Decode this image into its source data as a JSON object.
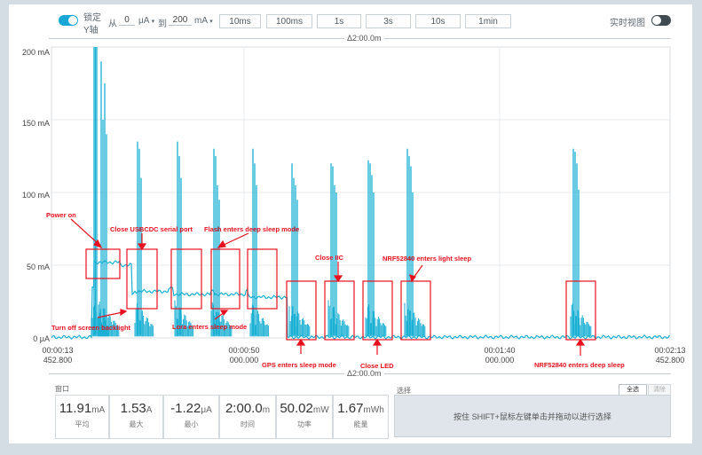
{
  "toolbar": {
    "lock_label": "锁定",
    "yaxis_label": "Y轴",
    "from_label": "从",
    "from_value": "0",
    "from_unit": "μA",
    "to_label": "到",
    "to_value": "200",
    "to_unit": "mA",
    "time_buttons": [
      "10ms",
      "100ms",
      "1s",
      "3s",
      "10s",
      "1min"
    ],
    "realtime_label": "实时视图",
    "lock_toggle_on": true,
    "realtime_toggle_on": false
  },
  "chart": {
    "duration_top": "Δ2:00.0m",
    "duration_bottom": "Δ2:00.0m",
    "y_ticks": [
      "200 mA",
      "150 mA",
      "100 mA",
      "50 mA",
      "0 μA"
    ],
    "x_ticks": [
      {
        "time": "00:00:13",
        "sub": "452.800"
      },
      {
        "time": "00:00:50",
        "sub": "000.000"
      },
      {
        "time": "00:01:40",
        "sub": "000.000"
      },
      {
        "time": "00:02:13",
        "sub": "452.800"
      }
    ],
    "trace_color": "#1ab0d4",
    "annotation_color": "#e8101e"
  },
  "annotations": [
    "Power on",
    "Close USBCDC serial port",
    "Flash enters deep sleep mode",
    "Close IIC",
    "NRF52840 enters light sleep",
    "Turn off screen backlight",
    "Lora enters sleep mode",
    "GPS enters sleep mode",
    "Close LED",
    "NRF52840 enters deep sleep"
  ],
  "window": {
    "title": "窗口",
    "stats": [
      {
        "value": "11.91",
        "unit": "mA",
        "label": "平均"
      },
      {
        "value": "1.53",
        "unit": "A",
        "label": "最大"
      },
      {
        "value": "-1.22",
        "unit": "μA",
        "label": "最小"
      },
      {
        "value": "2:00.0",
        "unit": "m",
        "label": "时间"
      },
      {
        "value": "50.02",
        "unit": "mW",
        "label": "功率"
      },
      {
        "value": "1.67",
        "unit": "mWh",
        "label": "能量"
      }
    ]
  },
  "selection": {
    "title": "选择",
    "select_all_label": "全选",
    "clear_label": "清除",
    "hint": "按住 SHIFT+鼠标左键单击并拖动以进行选择"
  }
}
